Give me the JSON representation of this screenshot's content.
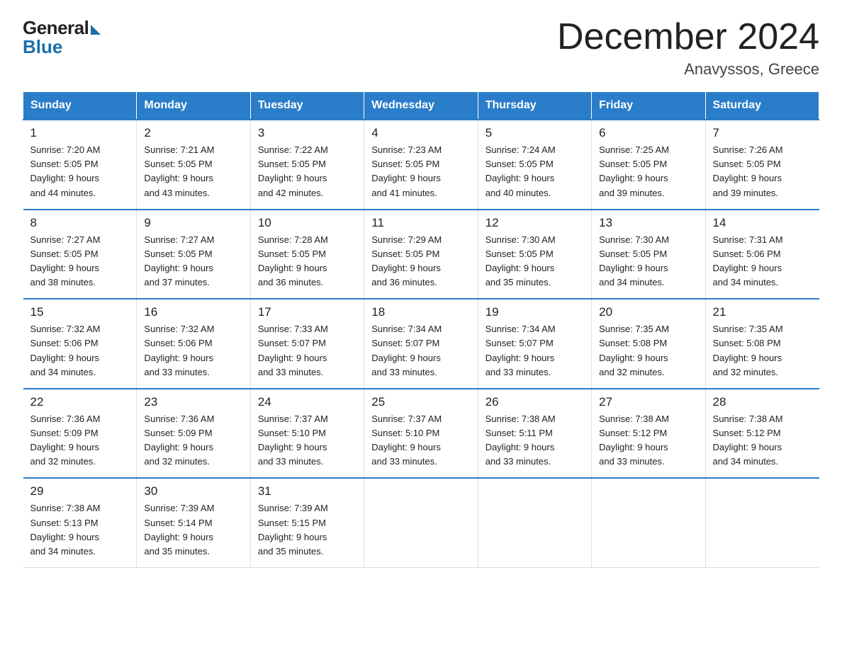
{
  "logo": {
    "general": "General",
    "blue": "Blue"
  },
  "header": {
    "title": "December 2024",
    "subtitle": "Anavyssos, Greece"
  },
  "days_of_week": [
    "Sunday",
    "Monday",
    "Tuesday",
    "Wednesday",
    "Thursday",
    "Friday",
    "Saturday"
  ],
  "weeks": [
    [
      {
        "day": "1",
        "sunrise": "7:20 AM",
        "sunset": "5:05 PM",
        "daylight": "9 hours and 44 minutes."
      },
      {
        "day": "2",
        "sunrise": "7:21 AM",
        "sunset": "5:05 PM",
        "daylight": "9 hours and 43 minutes."
      },
      {
        "day": "3",
        "sunrise": "7:22 AM",
        "sunset": "5:05 PM",
        "daylight": "9 hours and 42 minutes."
      },
      {
        "day": "4",
        "sunrise": "7:23 AM",
        "sunset": "5:05 PM",
        "daylight": "9 hours and 41 minutes."
      },
      {
        "day": "5",
        "sunrise": "7:24 AM",
        "sunset": "5:05 PM",
        "daylight": "9 hours and 40 minutes."
      },
      {
        "day": "6",
        "sunrise": "7:25 AM",
        "sunset": "5:05 PM",
        "daylight": "9 hours and 39 minutes."
      },
      {
        "day": "7",
        "sunrise": "7:26 AM",
        "sunset": "5:05 PM",
        "daylight": "9 hours and 39 minutes."
      }
    ],
    [
      {
        "day": "8",
        "sunrise": "7:27 AM",
        "sunset": "5:05 PM",
        "daylight": "9 hours and 38 minutes."
      },
      {
        "day": "9",
        "sunrise": "7:27 AM",
        "sunset": "5:05 PM",
        "daylight": "9 hours and 37 minutes."
      },
      {
        "day": "10",
        "sunrise": "7:28 AM",
        "sunset": "5:05 PM",
        "daylight": "9 hours and 36 minutes."
      },
      {
        "day": "11",
        "sunrise": "7:29 AM",
        "sunset": "5:05 PM",
        "daylight": "9 hours and 36 minutes."
      },
      {
        "day": "12",
        "sunrise": "7:30 AM",
        "sunset": "5:05 PM",
        "daylight": "9 hours and 35 minutes."
      },
      {
        "day": "13",
        "sunrise": "7:30 AM",
        "sunset": "5:05 PM",
        "daylight": "9 hours and 34 minutes."
      },
      {
        "day": "14",
        "sunrise": "7:31 AM",
        "sunset": "5:06 PM",
        "daylight": "9 hours and 34 minutes."
      }
    ],
    [
      {
        "day": "15",
        "sunrise": "7:32 AM",
        "sunset": "5:06 PM",
        "daylight": "9 hours and 34 minutes."
      },
      {
        "day": "16",
        "sunrise": "7:32 AM",
        "sunset": "5:06 PM",
        "daylight": "9 hours and 33 minutes."
      },
      {
        "day": "17",
        "sunrise": "7:33 AM",
        "sunset": "5:07 PM",
        "daylight": "9 hours and 33 minutes."
      },
      {
        "day": "18",
        "sunrise": "7:34 AM",
        "sunset": "5:07 PM",
        "daylight": "9 hours and 33 minutes."
      },
      {
        "day": "19",
        "sunrise": "7:34 AM",
        "sunset": "5:07 PM",
        "daylight": "9 hours and 33 minutes."
      },
      {
        "day": "20",
        "sunrise": "7:35 AM",
        "sunset": "5:08 PM",
        "daylight": "9 hours and 32 minutes."
      },
      {
        "day": "21",
        "sunrise": "7:35 AM",
        "sunset": "5:08 PM",
        "daylight": "9 hours and 32 minutes."
      }
    ],
    [
      {
        "day": "22",
        "sunrise": "7:36 AM",
        "sunset": "5:09 PM",
        "daylight": "9 hours and 32 minutes."
      },
      {
        "day": "23",
        "sunrise": "7:36 AM",
        "sunset": "5:09 PM",
        "daylight": "9 hours and 32 minutes."
      },
      {
        "day": "24",
        "sunrise": "7:37 AM",
        "sunset": "5:10 PM",
        "daylight": "9 hours and 33 minutes."
      },
      {
        "day": "25",
        "sunrise": "7:37 AM",
        "sunset": "5:10 PM",
        "daylight": "9 hours and 33 minutes."
      },
      {
        "day": "26",
        "sunrise": "7:38 AM",
        "sunset": "5:11 PM",
        "daylight": "9 hours and 33 minutes."
      },
      {
        "day": "27",
        "sunrise": "7:38 AM",
        "sunset": "5:12 PM",
        "daylight": "9 hours and 33 minutes."
      },
      {
        "day": "28",
        "sunrise": "7:38 AM",
        "sunset": "5:12 PM",
        "daylight": "9 hours and 34 minutes."
      }
    ],
    [
      {
        "day": "29",
        "sunrise": "7:38 AM",
        "sunset": "5:13 PM",
        "daylight": "9 hours and 34 minutes."
      },
      {
        "day": "30",
        "sunrise": "7:39 AM",
        "sunset": "5:14 PM",
        "daylight": "9 hours and 35 minutes."
      },
      {
        "day": "31",
        "sunrise": "7:39 AM",
        "sunset": "5:15 PM",
        "daylight": "9 hours and 35 minutes."
      },
      null,
      null,
      null,
      null
    ]
  ],
  "labels": {
    "sunrise": "Sunrise:",
    "sunset": "Sunset:",
    "daylight": "Daylight:"
  }
}
